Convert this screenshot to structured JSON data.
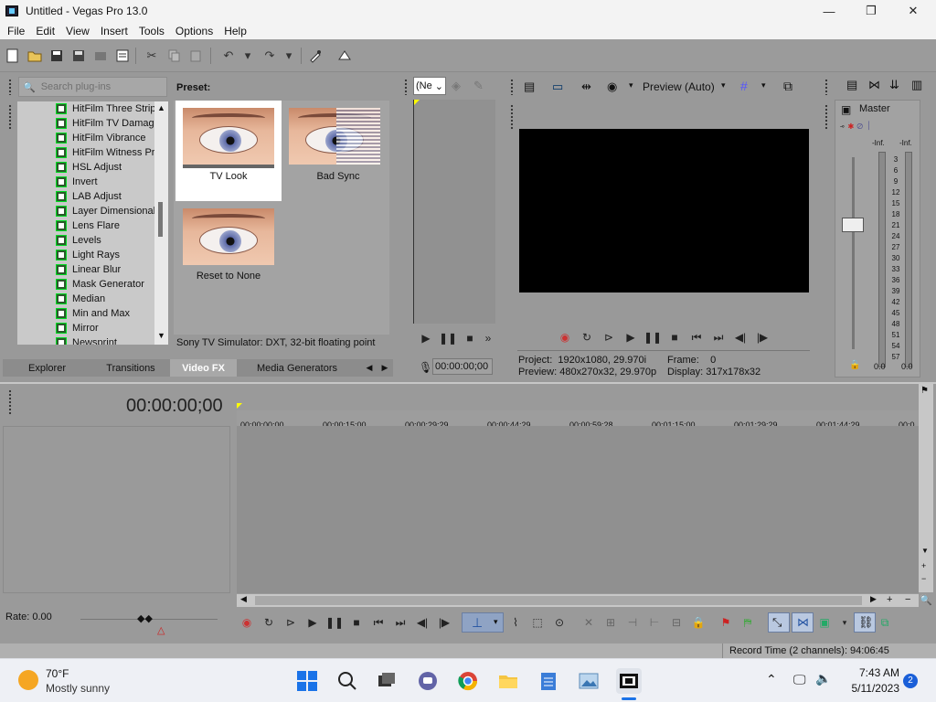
{
  "window": {
    "title": "Untitled - Vegas Pro 13.0",
    "minimize": "—",
    "maximize": "❐",
    "close": "✕"
  },
  "menu": [
    "File",
    "Edit",
    "View",
    "Insert",
    "Tools",
    "Options",
    "Help"
  ],
  "plugins": {
    "search_placeholder": "Search plug-ins",
    "items": [
      "HitFilm Three Strip",
      "HitFilm TV Damage",
      "HitFilm Vibrance",
      "HitFilm Witness Pr",
      "HSL Adjust",
      "Invert",
      "LAB Adjust",
      "Layer Dimensional",
      "Lens Flare",
      "Levels",
      "Light Rays",
      "Linear Blur",
      "Mask Generator",
      "Median",
      "Min and Max",
      "Mirror",
      "Newsprint"
    ]
  },
  "presets": {
    "header": "Preset:",
    "items": [
      "TV Look",
      "Bad Sync",
      "Reset to None"
    ],
    "description": "Sony TV Simulator: DXT, 32-bit floating point"
  },
  "tabs": {
    "left": [
      "Explorer",
      "Transitions",
      "Video FX",
      "Media Generators"
    ],
    "active": "Video FX",
    "left_arrow": "◀",
    "right_arrow": "▶"
  },
  "trimmer": {
    "dropdown": "(Ne",
    "timecode": "00:00:00;00"
  },
  "preview": {
    "mode": "Preview (Auto)",
    "project_label": "Project:",
    "project_value": "1920x1080, 29.970i",
    "frame_label": "Frame:",
    "frame_value": "0",
    "preview_label": "Preview:",
    "preview_value": "480x270x32, 29.970p",
    "display_label": "Display:",
    "display_value": "317x178x32"
  },
  "mixer": {
    "title": "Master",
    "left_inf": "-Inf.",
    "right_inf": "-Inf.",
    "scale": [
      "3",
      "6",
      "9",
      "12",
      "15",
      "18",
      "21",
      "24",
      "27",
      "30",
      "33",
      "36",
      "39",
      "42",
      "45",
      "48",
      "51",
      "54",
      "57"
    ],
    "left_value": "0.0",
    "right_value": "0.0"
  },
  "timeline": {
    "timecode": "00:00:00;00",
    "ruler": [
      "00:00:00;00",
      "00:00:15;00",
      "00:00:29;29",
      "00:00:44;29",
      "00:00:59;28",
      "00:01:15;00",
      "00:01:29;29",
      "00:01:44;29",
      "00:0"
    ],
    "rate": "Rate: 0.00",
    "record_time": "Record Time (2 channels): 94:06:45"
  },
  "taskbar": {
    "weather_temp": "70°F",
    "weather_desc": "Mostly sunny",
    "time": "7:43 AM",
    "date": "5/11/2023",
    "notifications": "2"
  }
}
